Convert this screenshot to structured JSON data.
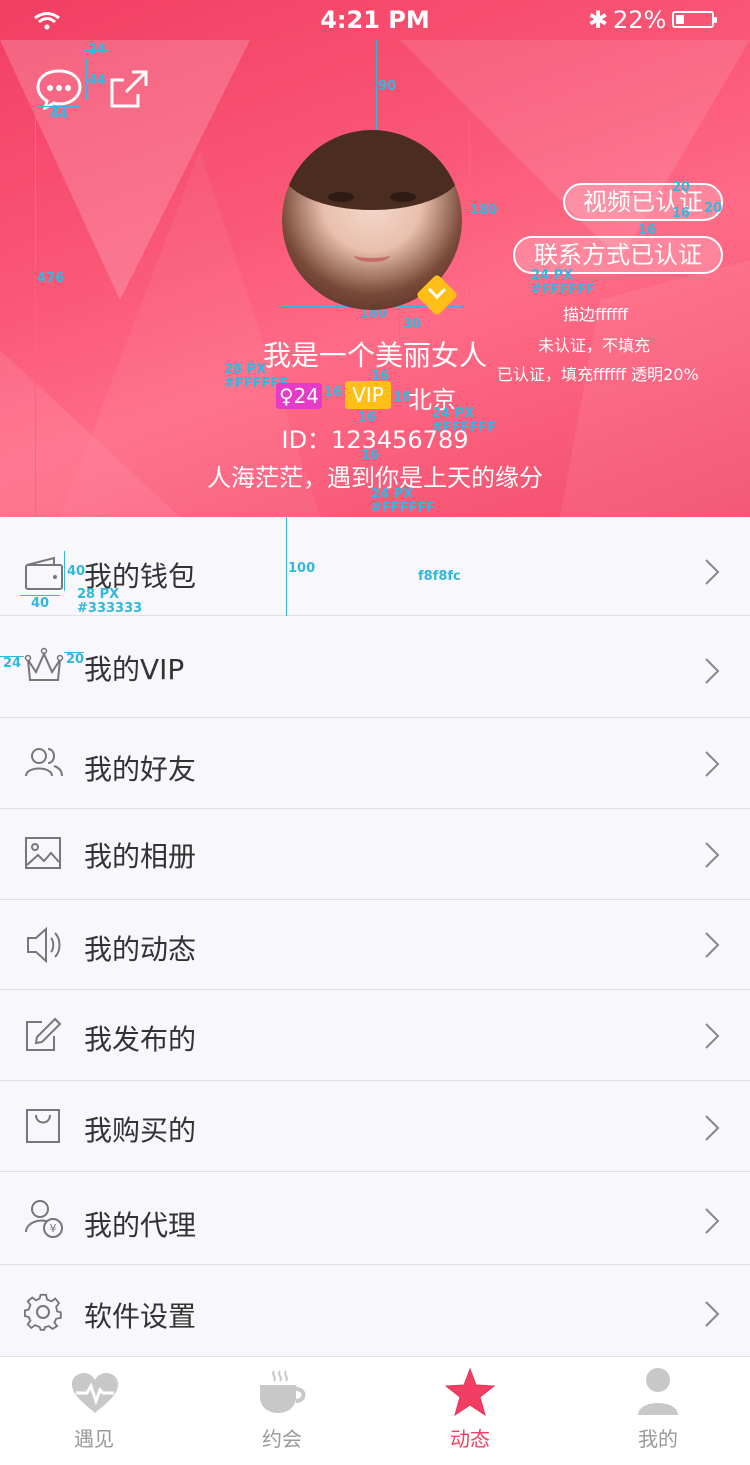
{
  "status_bar": {
    "time": "4:21 PM",
    "battery": "22%",
    "bluetooth": "✱"
  },
  "profile": {
    "name": "我是一个美丽女人",
    "age_tag": "♀24",
    "vip_tag": "VIP",
    "city": "北京",
    "id": "ID：123456789",
    "motto": "人海茫茫，遇到你是上天的缘分",
    "badges": [
      "视频已认证",
      "联系方式已认证"
    ],
    "icons": {
      "message": "chat-bubble-icon",
      "share": "share-icon",
      "verified": "verified-badge-icon"
    }
  },
  "annotations": {
    "a24": "24",
    "a44h": "44",
    "a44w": "44",
    "a90": "90",
    "a180v": "180",
    "a180h": "180",
    "a476": "476",
    "a30": "30",
    "a16a": "16",
    "a16b": "16",
    "a16c": "16",
    "a16d": "16",
    "a16e": "16",
    "a16f": "16",
    "a16g": "16",
    "a20top": "20",
    "a20side": "20",
    "font28": "28 PX",
    "col_fff1": "#FFFFFF",
    "font24a": "24 PX",
    "col_fff2": "#FFFFFF",
    "font24b": "24 PX",
    "col_fff3": "#FFFFFF",
    "font24c": "24 PX",
    "col_fff4": "#FFFFFF",
    "note1": "描边ffffff",
    "note2": "未认证，不填充",
    "note3": "已认证，填充ffffff 透明20%",
    "a100": "100",
    "bgnote": "f8f8fc",
    "a40v": "40",
    "a40h": "40",
    "font28b": "28 PX",
    "col333": "#333333",
    "a24left": "24",
    "a20right": "20"
  },
  "menu": [
    {
      "label": "我的钱包",
      "icon": "wallet-icon"
    },
    {
      "label": "我的VIP",
      "icon": "crown-icon"
    },
    {
      "label": "我的好友",
      "icon": "friends-icon"
    },
    {
      "label": "我的相册",
      "icon": "album-icon"
    },
    {
      "label": "我的动态",
      "icon": "speaker-icon"
    },
    {
      "label": "我发布的",
      "icon": "edit-icon"
    },
    {
      "label": "我购买的",
      "icon": "bag-icon"
    },
    {
      "label": "我的代理",
      "icon": "agent-icon"
    },
    {
      "label": "软件设置",
      "icon": "gear-icon"
    }
  ],
  "tabs": [
    {
      "label": "遇见",
      "icon": "heart-pulse-icon"
    },
    {
      "label": "约会",
      "icon": "coffee-icon"
    },
    {
      "label": "动态",
      "icon": "star-icon",
      "active": true
    },
    {
      "label": "我的",
      "icon": "person-icon"
    }
  ],
  "colors": {
    "accent": "#f2466a",
    "active_tab": "#f23e62",
    "text": "#333333",
    "list_bg": "#f8f8fc",
    "gold": "#ffbf17",
    "magenta": "#e63ac8"
  }
}
